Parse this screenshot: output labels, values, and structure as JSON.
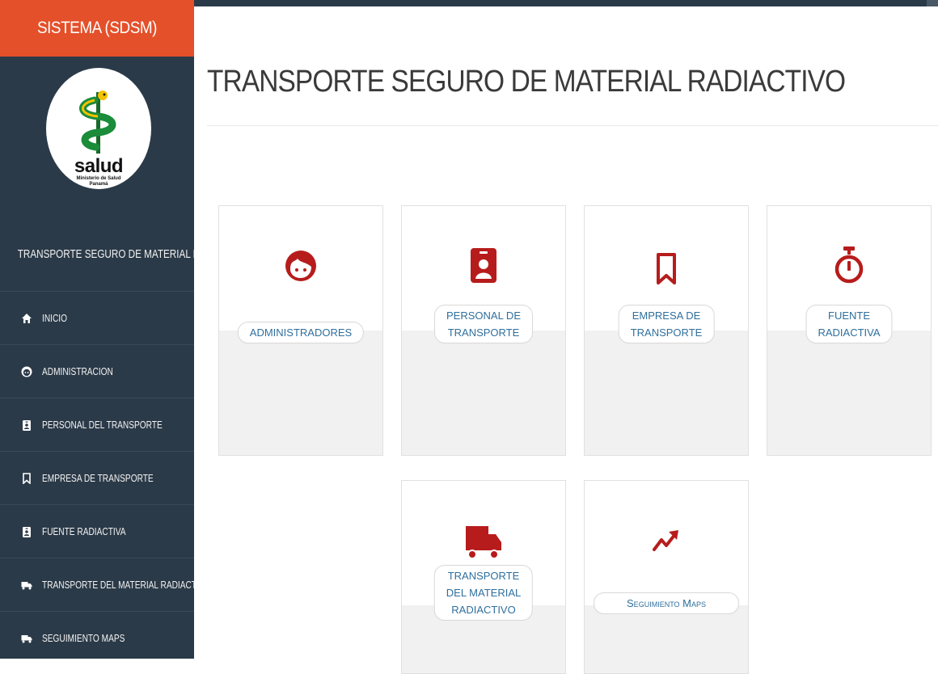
{
  "brand": {
    "title": "SISTEMA (SDSM)"
  },
  "logo": {
    "word": "salud",
    "line1": "Ministerio de Salud",
    "line2": "Panamá"
  },
  "site_name": "TRANSPORTE SEGURO DE MATERIAL RADIACTIVO",
  "nav": {
    "items": [
      {
        "label": "INICIO",
        "icon": "home-icon"
      },
      {
        "label": "ADMINISTRACION",
        "icon": "face-icon"
      },
      {
        "label": "PERSONAL DEL TRANSPORTE",
        "icon": "id-badge-icon"
      },
      {
        "label": "EMPRESA DE TRANSPORTE",
        "icon": "bookmark-icon"
      },
      {
        "label": "FUENTE RADIACTIVA",
        "icon": "id-badge-icon"
      },
      {
        "label": "TRANSPORTE DEL MATERIAL RADIACTIVO",
        "icon": "truck-icon"
      },
      {
        "label": "SEGUIMIENTO MAPS",
        "icon": "truck-icon"
      }
    ]
  },
  "page": {
    "title": "TRANSPORTE SEGURO DE MATERIAL RADIACTIVO"
  },
  "tiles": [
    {
      "line1": "ADMINISTRADORES",
      "line2": "",
      "line3": "",
      "icon": "face-icon"
    },
    {
      "line1": "PERSONAL DE",
      "line2": "TRANSPORTE",
      "line3": "",
      "icon": "id-badge-icon"
    },
    {
      "line1": "EMPRESA DE",
      "line2": "TRANSPORTE",
      "line3": "",
      "icon": "bookmark-icon"
    },
    {
      "line1": "FUENTE",
      "line2": "RADIACTIVA",
      "line3": "",
      "icon": "stopwatch-icon"
    },
    {
      "line1": "TRANSPORTE",
      "line2": "DEL MATERIAL",
      "line3": "RADIACTIVO",
      "icon": "truck-icon"
    },
    {
      "line1": "Seguimiento Maps",
      "line2": "",
      "line3": "",
      "icon": "trend-up-icon"
    }
  ],
  "colors": {
    "sidebar": "#2b3a48",
    "brand": "#e4502a",
    "icon_red": "#b71c1c",
    "link_blue": "#2f6f9d"
  }
}
